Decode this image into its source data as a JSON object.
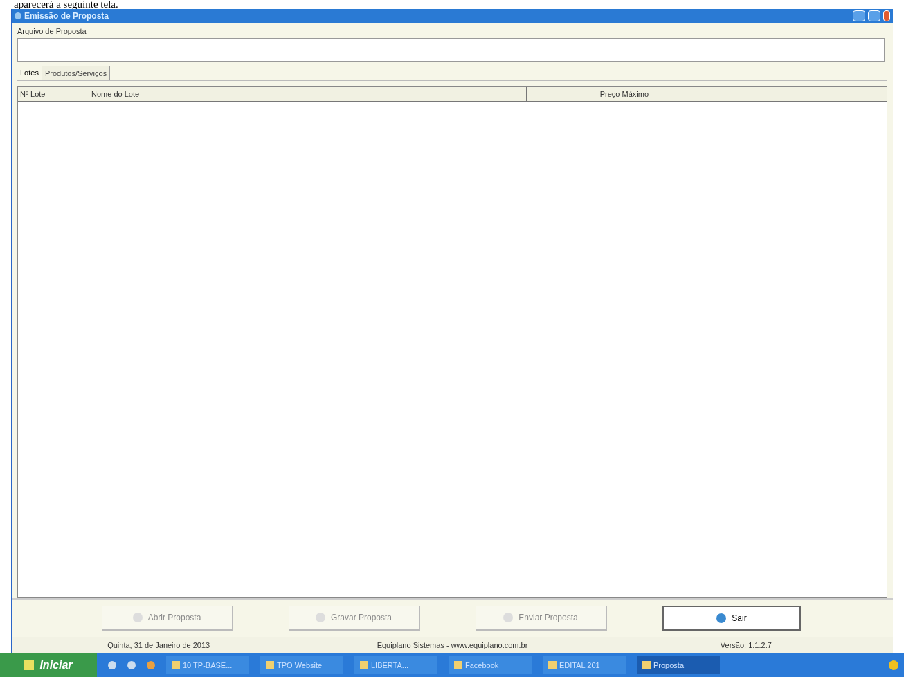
{
  "caption": "aparecerá a seguinte tela.",
  "window": {
    "title": "Emissão de Proposta"
  },
  "file_field": {
    "label": "Arquivo de Proposta"
  },
  "tabs": [
    {
      "label": "Lotes",
      "selected": true
    },
    {
      "label": "Produtos/Serviços",
      "selected": false
    }
  ],
  "table": {
    "columns": [
      "Nº Lote",
      "Nome do Lote",
      "Preço Máximo"
    ]
  },
  "buttons": [
    {
      "label": "Abrir Proposta",
      "disabled": true
    },
    {
      "label": "Gravar Proposta",
      "disabled": true
    },
    {
      "label": "Enviar Proposta",
      "disabled": true
    },
    {
      "label": "Sair",
      "disabled": false
    }
  ],
  "status_bar": [
    "Quinta, 31 de Janeiro de 2013",
    "Equiplano Sistemas - www.equiplano.com.br",
    "Versão: 1.1.2.7"
  ],
  "taskbar": {
    "start": "Iniciar",
    "items": [
      {
        "label": "10 TP-BASE...",
        "selected": false
      },
      {
        "label": "TPO Website",
        "selected": false
      },
      {
        "label": "LIBERTA...",
        "selected": false
      },
      {
        "label": "Facebook",
        "selected": false
      },
      {
        "label": "EDITAL 201",
        "selected": false
      },
      {
        "label": "Proposta",
        "selected": true
      }
    ]
  }
}
